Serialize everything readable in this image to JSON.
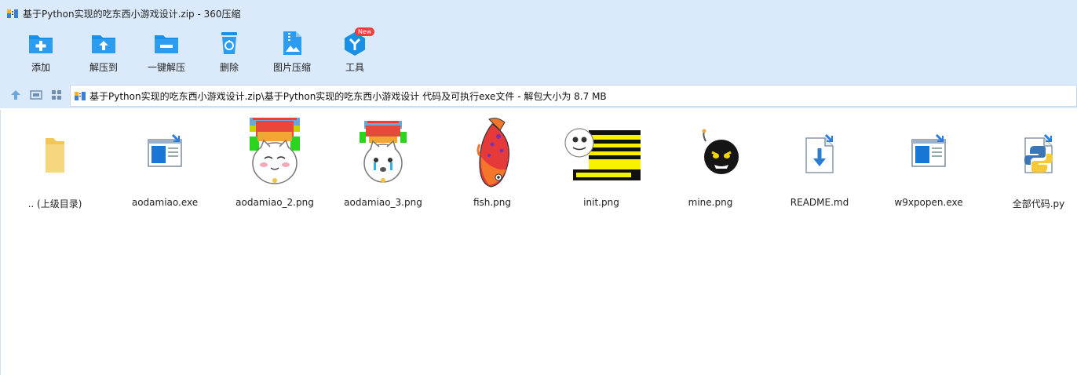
{
  "window": {
    "title": "基于Python实现的吃东西小游戏设计.zip - 360压缩"
  },
  "toolbar": {
    "items": [
      {
        "label": "添加",
        "icon": "add-folder-icon"
      },
      {
        "label": "解压到",
        "icon": "extract-to-icon"
      },
      {
        "label": "一键解压",
        "icon": "one-click-extract-icon"
      },
      {
        "label": "删除",
        "icon": "delete-icon"
      },
      {
        "label": "图片压缩",
        "icon": "image-compress-icon"
      },
      {
        "label": "工具",
        "icon": "tools-icon",
        "badge": "New"
      }
    ]
  },
  "address": {
    "path": "基于Python实现的吃东西小游戏设计.zip\\基于Python实现的吃东西小游戏设计 代码及可执行exe文件 - 解包大小为 8.7 MB"
  },
  "files": [
    {
      "name": ".. (上级目录)",
      "icon": "folder-icon"
    },
    {
      "name": "aodamiao.exe",
      "icon": "exe-icon"
    },
    {
      "name": "aodamiao_2.png",
      "icon": "cat-image-thumbnail"
    },
    {
      "name": "aodamiao_3.png",
      "icon": "cat-image-thumbnail"
    },
    {
      "name": "fish.png",
      "icon": "fish-image-thumbnail"
    },
    {
      "name": "init.png",
      "icon": "init-image-thumbnail"
    },
    {
      "name": "mine.png",
      "icon": "bomb-image-thumbnail"
    },
    {
      "name": "README.md",
      "icon": "markdown-file-icon"
    },
    {
      "name": "w9xpopen.exe",
      "icon": "exe-icon"
    },
    {
      "name": "全部代码.py",
      "icon": "python-file-icon"
    }
  ],
  "colors": {
    "chrome": "#dbeafa",
    "accent": "#1a8fe6"
  }
}
